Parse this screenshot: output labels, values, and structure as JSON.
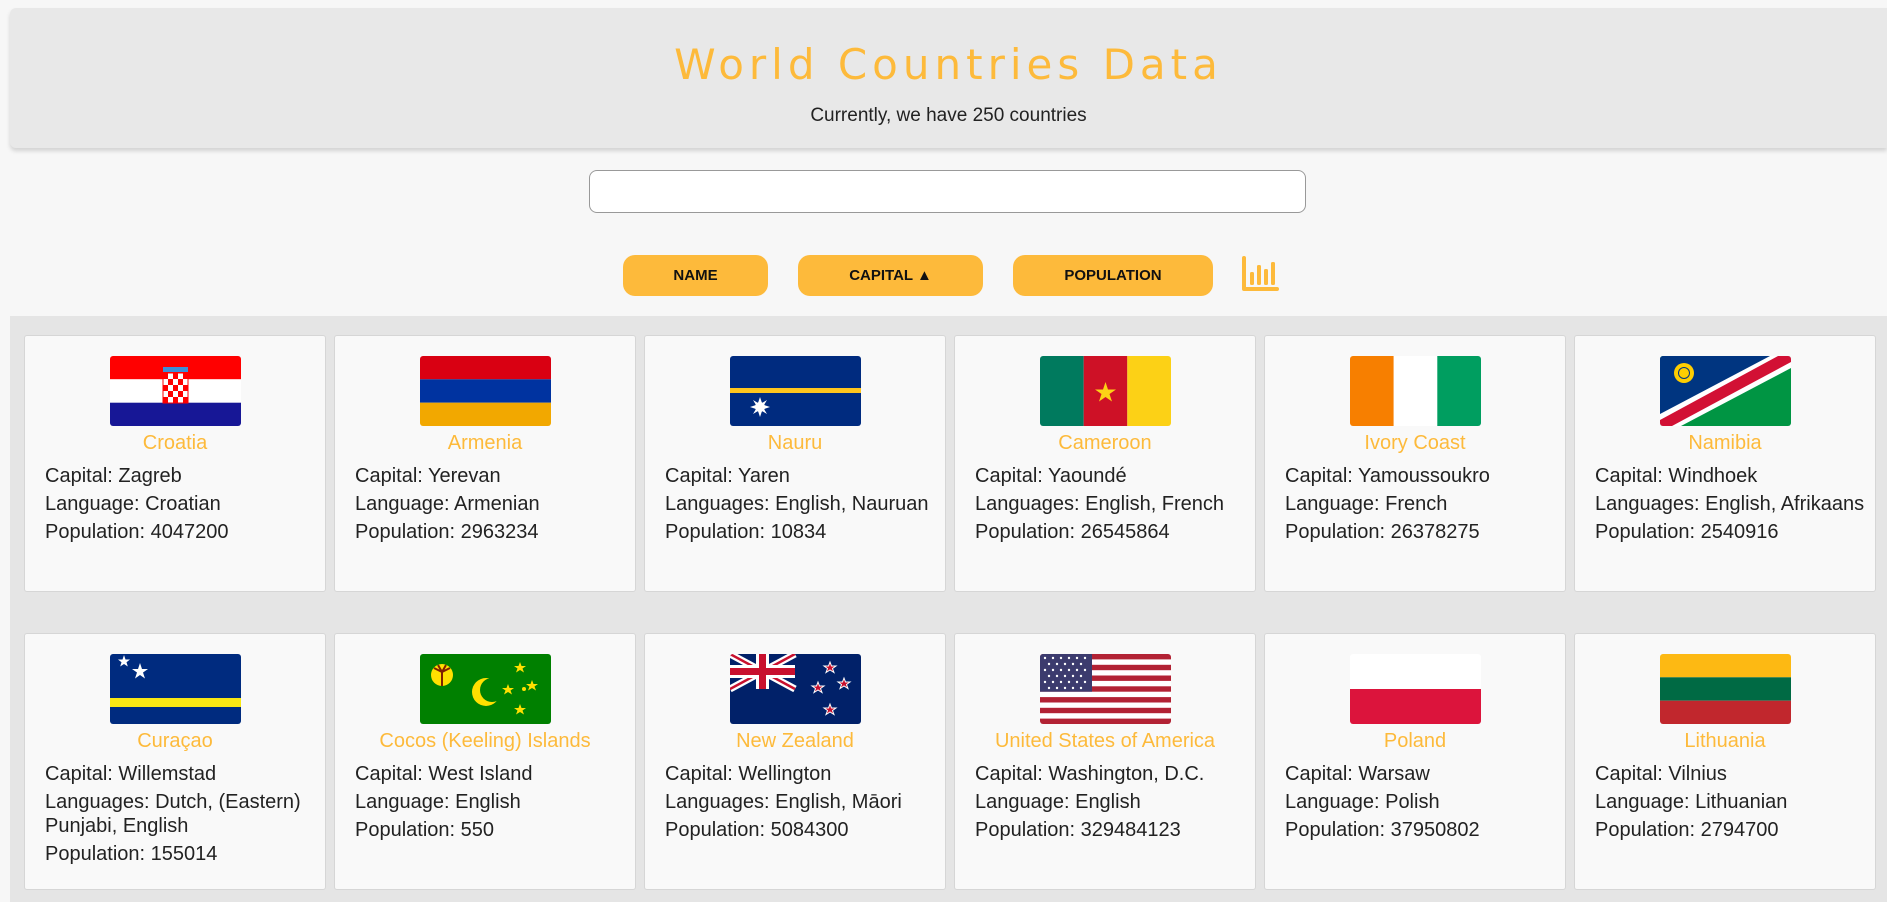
{
  "header": {
    "title": "World Countries Data",
    "subtitle": "Currently, we have 250 countries"
  },
  "search": {
    "value": "",
    "placeholder": ""
  },
  "sort_buttons": {
    "name": "NAME",
    "capital": "CAPITAL ▲",
    "population": "POPULATION"
  },
  "icons": {
    "stats": "bar-chart-icon"
  },
  "colors": {
    "accent": "#fdba3b"
  },
  "countries": [
    {
      "name": "Croatia",
      "capital": "Capital: Zagreb",
      "language": "Language: Croatian",
      "population": "Population: 4047200"
    },
    {
      "name": "Armenia",
      "capital": "Capital: Yerevan",
      "language": "Language: Armenian",
      "population": "Population: 2963234"
    },
    {
      "name": "Nauru",
      "capital": "Capital: Yaren",
      "language": "Languages: English, Nauruan",
      "population": "Population: 10834"
    },
    {
      "name": "Cameroon",
      "capital": "Capital: Yaoundé",
      "language": "Languages: English, French",
      "population": "Population: 26545864"
    },
    {
      "name": "Ivory Coast",
      "capital": "Capital: Yamoussoukro",
      "language": "Language: French",
      "population": "Population: 26378275"
    },
    {
      "name": "Namibia",
      "capital": "Capital: Windhoek",
      "language": "Languages: English, Afrikaans",
      "population": "Population: 2540916"
    },
    {
      "name": "Curaçao",
      "capital": "Capital: Willemstad",
      "language": "Languages: Dutch, (Eastern) Punjabi, English",
      "population": "Population: 155014"
    },
    {
      "name": "Cocos (Keeling) Islands",
      "capital": "Capital: West Island",
      "language": "Language: English",
      "population": "Population: 550"
    },
    {
      "name": "New Zealand",
      "capital": "Capital: Wellington",
      "language": "Languages: English, Māori",
      "population": "Population: 5084300"
    },
    {
      "name": "United States of America",
      "capital": "Capital: Washington, D.C.",
      "language": "Language: English",
      "population": "Population: 329484123"
    },
    {
      "name": "Poland",
      "capital": "Capital: Warsaw",
      "language": "Language: Polish",
      "population": "Population: 37950802"
    },
    {
      "name": "Lithuania",
      "capital": "Capital: Vilnius",
      "language": "Language: Lithuanian",
      "population": "Population: 2794700"
    }
  ]
}
